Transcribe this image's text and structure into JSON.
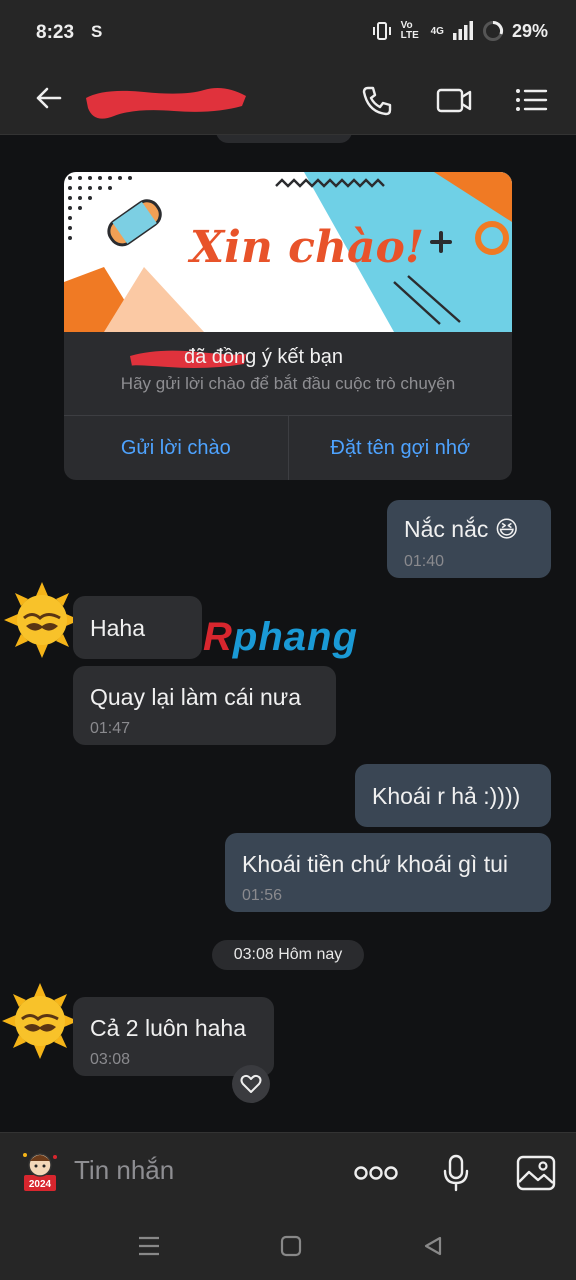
{
  "status_bar": {
    "time": "8:23",
    "carrier_glyph": "S",
    "volte": "Vo LTE",
    "network": "4G",
    "battery": "29%"
  },
  "header": {
    "contact_name": "",
    "icons": [
      "back-arrow-icon",
      "phone-icon",
      "video-call-icon",
      "menu-list-icon"
    ]
  },
  "friend_card": {
    "banner_text": "Xin chào!",
    "title": "đã đồng ý kết bạn",
    "subtitle": "Hãy gửi lời chào để bắt đầu cuộc trò chuyện",
    "button_send_greeting": "Gửi lời chào",
    "button_set_nickname": "Đặt tên gợi nhớ"
  },
  "messages": [
    {
      "dir": "out",
      "text": "Nắc nắc 😆",
      "time": "01:40"
    },
    {
      "dir": "in",
      "text": "Haha",
      "time": ""
    },
    {
      "dir": "in",
      "text": "Quay lại làm cái nưa",
      "time": "01:47"
    },
    {
      "dir": "out",
      "text": "Khoái r hả :))))",
      "time": ""
    },
    {
      "dir": "out",
      "text": "Khoái tiền chứ khoái gì tui",
      "time": "01:56"
    },
    {
      "dir": "in",
      "text": "Cả 2 luôn haha",
      "time": "03:08"
    }
  ],
  "date_separator": "03:08 Hôm nay",
  "watermark": {
    "part1": "R",
    "part2": "phang"
  },
  "composer": {
    "placeholder": "Tin nhắn",
    "icons": [
      "sticker-icon",
      "more-icon",
      "microphone-icon",
      "image-icon"
    ]
  },
  "colors": {
    "background": "#111214",
    "bar": "#262626",
    "outgoing_bubble": "#3a4654",
    "incoming_bubble": "#2d2e31",
    "link_blue": "#4ea3ff"
  }
}
